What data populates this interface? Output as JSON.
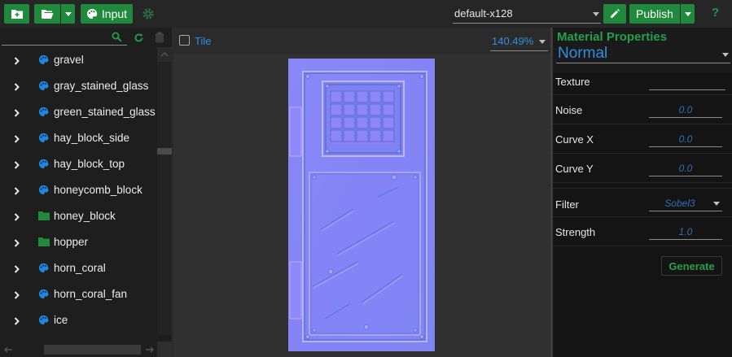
{
  "toolbar": {
    "new_icon": "folder-plus-icon",
    "open_icon": "folder-open-icon",
    "input_label": "Input",
    "input_icon": "palette-icon",
    "settings_icon": "gear-icon",
    "preset_value": "default-x128",
    "edit_icon": "pencil-icon",
    "publish_label": "Publish",
    "help_label": "?"
  },
  "tree": {
    "search_placeholder": "",
    "items": [
      {
        "name": "gravel",
        "icon": "palette-icon"
      },
      {
        "name": "gray_stained_glass",
        "icon": "palette-icon"
      },
      {
        "name": "green_stained_glass",
        "icon": "palette-icon"
      },
      {
        "name": "hay_block_side",
        "icon": "palette-icon"
      },
      {
        "name": "hay_block_top",
        "icon": "palette-icon"
      },
      {
        "name": "honeycomb_block",
        "icon": "palette-icon"
      },
      {
        "name": "honey_block",
        "icon": "folder-icon"
      },
      {
        "name": "hopper",
        "icon": "folder-icon"
      },
      {
        "name": "horn_coral",
        "icon": "palette-icon"
      },
      {
        "name": "horn_coral_fan",
        "icon": "palette-icon"
      },
      {
        "name": "ice",
        "icon": "palette-icon"
      }
    ]
  },
  "viewer": {
    "tile_label": "Tile",
    "tile_checked": false,
    "zoom": "140.49%"
  },
  "properties": {
    "title": "Material Properties",
    "material": "Normal",
    "texture_label": "Texture",
    "texture_value": "",
    "noise_label": "Noise",
    "noise_value": "0.0",
    "curvex_label": "Curve X",
    "curvex_value": "0.0",
    "curvey_label": "Curve Y",
    "curvey_value": "0.0",
    "filter_label": "Filter",
    "filter_value": "Sobel3",
    "strength_label": "Strength",
    "strength_value": "1.0",
    "generate_label": "Generate"
  },
  "colors": {
    "accent_green": "#1f8a3c",
    "accent_blue": "#2f8fe0",
    "title_green": "#24a04b"
  }
}
